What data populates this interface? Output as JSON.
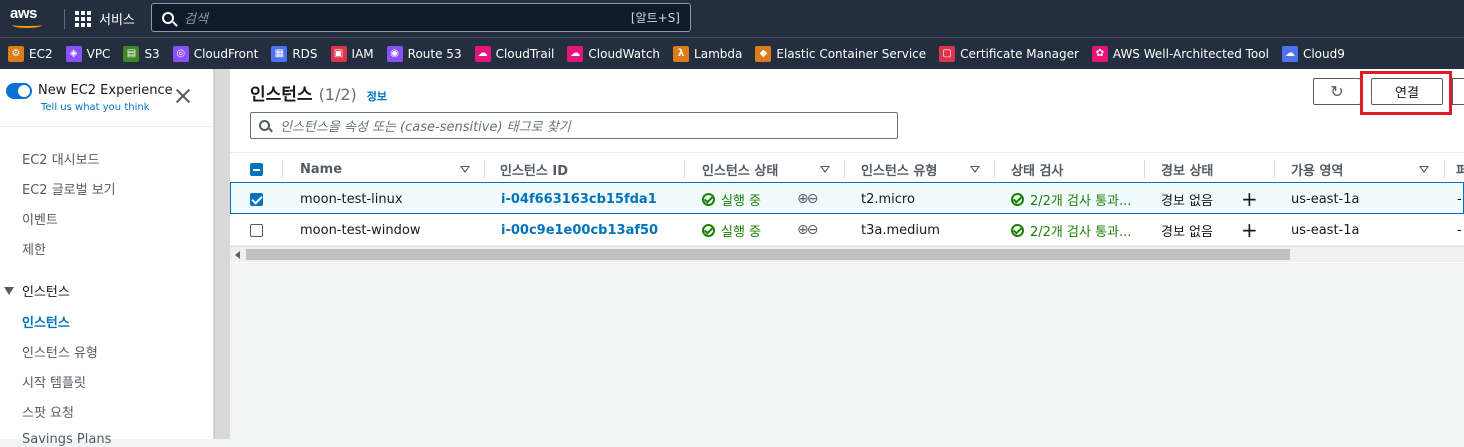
{
  "topbar": {
    "logo": "aws",
    "services_label": "서비스",
    "search_placeholder": "검색",
    "search_shortcut": "[알트+S]"
  },
  "favorites": [
    {
      "label": "EC2",
      "color": "#e07b1c",
      "icon": "ec2-icon"
    },
    {
      "label": "VPC",
      "color": "#8c4fff",
      "icon": "vpc-icon"
    },
    {
      "label": "S3",
      "color": "#3f8624",
      "icon": "s3-icon"
    },
    {
      "label": "CloudFront",
      "color": "#8c4fff",
      "icon": "cloudfront-icon"
    },
    {
      "label": "RDS",
      "color": "#4d72f3",
      "icon": "rds-icon"
    },
    {
      "label": "IAM",
      "color": "#dd344c",
      "icon": "iam-icon"
    },
    {
      "label": "Route 53",
      "color": "#8c4fff",
      "icon": "route53-icon"
    },
    {
      "label": "CloudTrail",
      "color": "#e7157b",
      "icon": "cloudtrail-icon"
    },
    {
      "label": "CloudWatch",
      "color": "#e7157b",
      "icon": "cloudwatch-icon"
    },
    {
      "label": "Lambda",
      "color": "#e07b1c",
      "icon": "lambda-icon"
    },
    {
      "label": "Elastic Container Service",
      "color": "#e07b1c",
      "icon": "ecs-icon"
    },
    {
      "label": "Certificate Manager",
      "color": "#dd344c",
      "icon": "certificate-icon"
    },
    {
      "label": "AWS Well-Architected Tool",
      "color": "#e7157b",
      "icon": "well-architected-icon"
    },
    {
      "label": "Cloud9",
      "color": "#4d72f3",
      "icon": "cloud9-icon"
    }
  ],
  "sidebar": {
    "experience_title": "New EC2 Experience",
    "experience_sub": "Tell us what you think",
    "items": [
      "EC2 대시보드",
      "EC2 글로벌 보기",
      "이벤트",
      "제한"
    ],
    "section": "인스턴스",
    "sub_items": [
      "인스턴스",
      "인스턴스 유형",
      "시작 템플릿",
      "스팟 요청",
      "Savings Plans"
    ]
  },
  "main": {
    "title": "인스턴스",
    "count": "(1/2)",
    "info": "정보",
    "connect_label": "연결",
    "refresh_icon": "refresh-icon",
    "search_placeholder": "인스턴스을 속성 또는 (case-sensitive) 태그로 찾기"
  },
  "table": {
    "headers": [
      "Name",
      "인스턴스 ID",
      "인스턴스 상태",
      "인스턴스 유형",
      "상태 검사",
      "경보 상태",
      "가용 영역",
      "퍼"
    ],
    "rows": [
      {
        "selected": true,
        "name": "moon-test-linux",
        "id": "i-04f663163cb15fda1",
        "state": "실행 중",
        "type": "t2.micro",
        "check": "2/2개 검사 통과...",
        "alarm": "경보 없음",
        "zone": "us-east-1a",
        "extra": "-"
      },
      {
        "selected": false,
        "name": "moon-test-window",
        "id": "i-00c9e1e00cb13af50",
        "state": "실행 중",
        "type": "t3a.medium",
        "check": "2/2개 검사 통과...",
        "alarm": "경보 없음",
        "zone": "us-east-1a",
        "extra": "-"
      }
    ]
  }
}
